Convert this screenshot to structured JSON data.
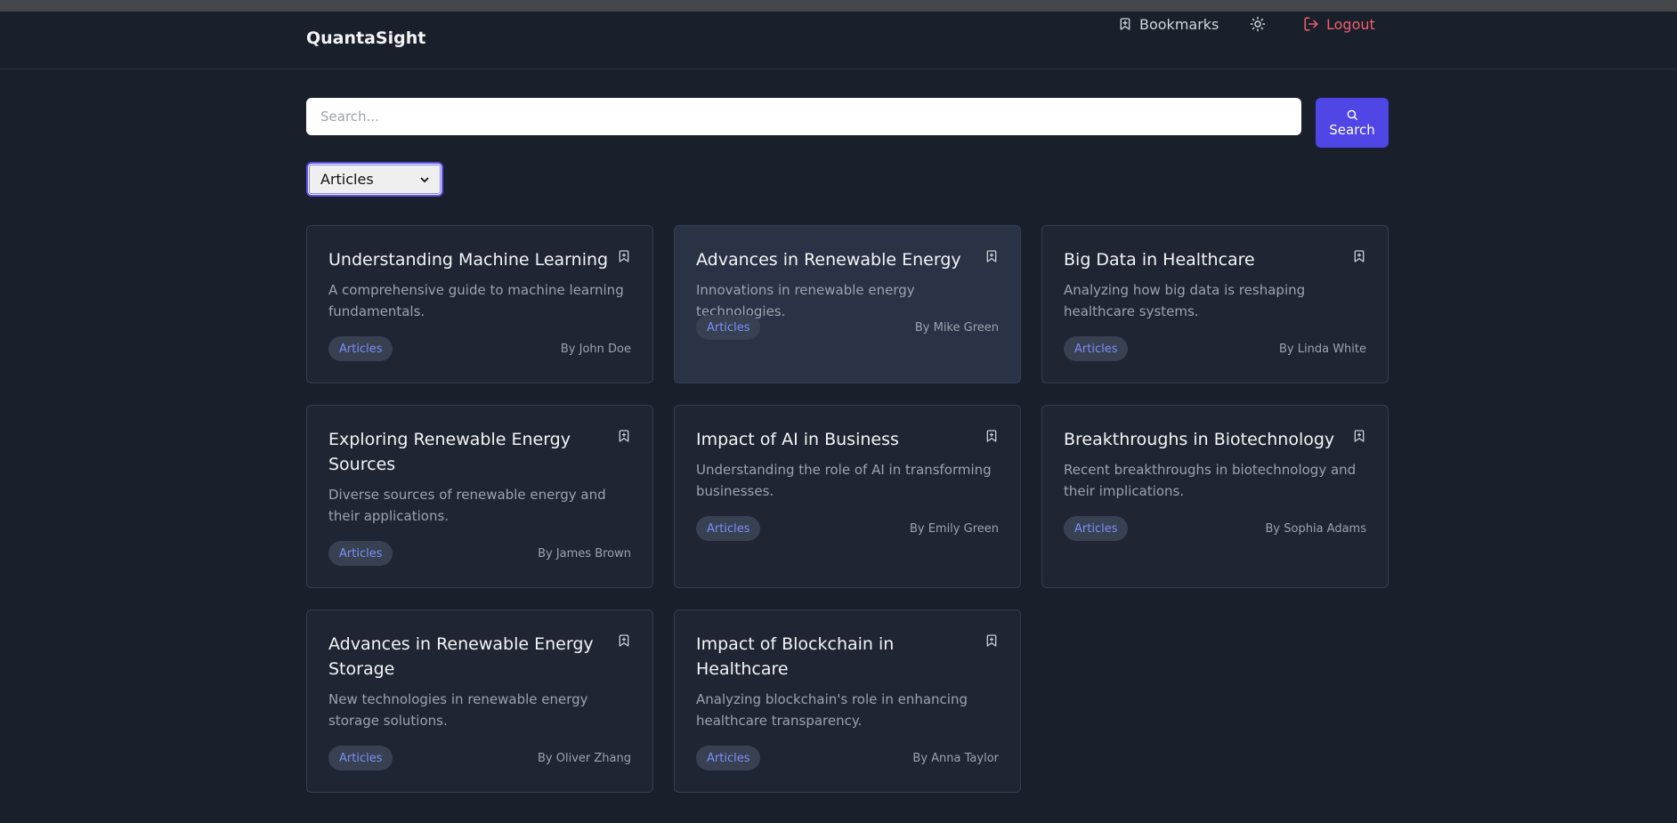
{
  "header": {
    "brand": "QuantaSight",
    "bookmarks_label": "Bookmarks",
    "logout_label": "Logout"
  },
  "search": {
    "placeholder": "Search...",
    "value": "",
    "button_label": "Search"
  },
  "filter": {
    "selected": "Articles"
  },
  "colors": {
    "background": "#1a1f2c",
    "card": "#1f2533",
    "accent": "#4f46e5",
    "tag_text": "#818cf8",
    "logout": "#f0606a"
  },
  "cards": [
    {
      "title": "Understanding Machine Learning",
      "description": "A comprehensive guide to machine learning fundamentals.",
      "tag": "Articles",
      "author": "By John Doe"
    },
    {
      "title": "Advances in Renewable Energy",
      "description": "Innovations in renewable energy technologies.",
      "tag": "Articles",
      "author": "By Mike Green"
    },
    {
      "title": "Big Data in Healthcare",
      "description": "Analyzing how big data is reshaping healthcare systems.",
      "tag": "Articles",
      "author": "By Linda White"
    },
    {
      "title": "Exploring Renewable Energy Sources",
      "description": "Diverse sources of renewable energy and their applications.",
      "tag": "Articles",
      "author": "By James Brown"
    },
    {
      "title": "Impact of AI in Business",
      "description": "Understanding the role of AI in transforming businesses.",
      "tag": "Articles",
      "author": "By Emily Green"
    },
    {
      "title": "Breakthroughs in Biotechnology",
      "description": "Recent breakthroughs in biotechnology and their implications.",
      "tag": "Articles",
      "author": "By Sophia Adams"
    },
    {
      "title": "Advances in Renewable Energy Storage",
      "description": "New technologies in renewable energy storage solutions.",
      "tag": "Articles",
      "author": "By Oliver Zhang"
    },
    {
      "title": "Impact of Blockchain in Healthcare",
      "description": "Analyzing blockchain's role in enhancing healthcare transparency.",
      "tag": "Articles",
      "author": "By Anna Taylor"
    }
  ]
}
